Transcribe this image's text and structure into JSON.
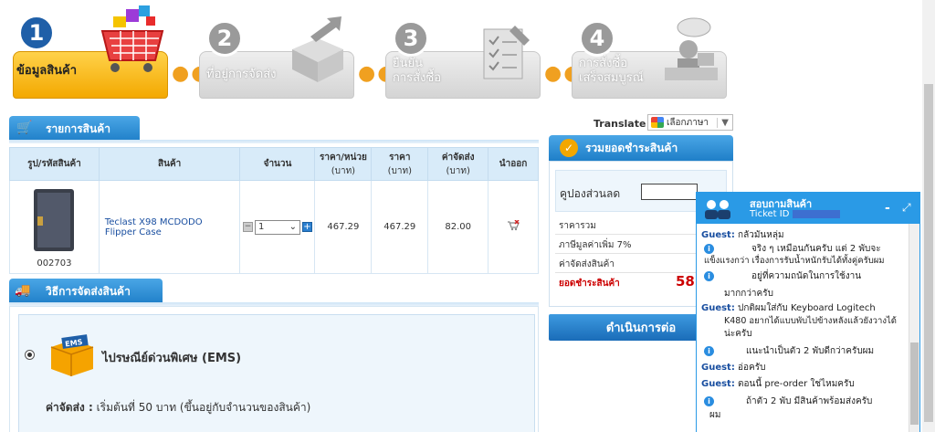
{
  "steps": [
    {
      "num": "1",
      "label": "ข้อมูลสินค้า"
    },
    {
      "num": "2",
      "label": "ที่อยู่การจัดส่ง"
    },
    {
      "num": "3",
      "label1": "ยืนยัน",
      "label2": "การสั่งซื้อ"
    },
    {
      "num": "4",
      "label1": "การสั่งซื้อ",
      "label2": "เสร็จสมบูรณ์"
    }
  ],
  "cart": {
    "title": "รายการสินค้า",
    "headers": {
      "image": "รูป/รหัสสินค้า",
      "product": "สินค้า",
      "qty": "จำนวน",
      "unit_price": "ราคา/หน่วย",
      "unit_price_sub": "(บาท)",
      "price": "ราคา",
      "price_sub": "(บาท)",
      "shipping": "ค่าจัดส่ง",
      "shipping_sub": "(บาท)",
      "remove": "นำออก"
    },
    "item": {
      "code": "002703",
      "name": "Teclast X98 MCDODO Flipper Case",
      "qty": "1",
      "unit_price": "467.29",
      "price": "467.29",
      "shipping": "82.00"
    }
  },
  "shipping": {
    "title": "วิธีการจัดส่งสินค้า",
    "method": "ไปรษณีย์ด่วนพิเศษ (EMS)",
    "logo_text": "EMS",
    "fee_label": "ค่าจัดส่ง :",
    "fee_text": "เริ่มต้นที่ 50 บาท (ขึ้นอยู่กับจำนวนของสินค้า)"
  },
  "translate": {
    "label": "Translate :",
    "select": "เลือกภาษา"
  },
  "summary": {
    "title": "รวมยอดชำระสินค้า",
    "coupon_label": "คูปองส่วนลด",
    "rows": [
      "ราคารวม",
      "ภาษีมูลค่าเพิ่ม 7%",
      "ค่าจัดส่งสินค้า"
    ],
    "total_label": "ยอดชำระสินค้า",
    "total_value": "58",
    "proceed": "ดำเนินการต่อ"
  },
  "chat": {
    "title": "สอบถามสินค้า",
    "ticket": "Ticket ID",
    "minimize": "-",
    "expand": "⤢",
    "lines": [
      {
        "who": "Guest:",
        "text": "กลัวมันหลุ่ม"
      },
      {
        "who": "",
        "text": "จริง ๆ เหมือนกันครับ แต่ 2 พับจะ"
      },
      {
        "who": "",
        "text": "แข็งแรงกว่า เรื่องการรับน้ำหนักรับได้ทั้งคู่ครับผม"
      },
      {
        "who": "",
        "text": "อยู่ที่ความถนัดในการใช้งาน"
      },
      {
        "who": "",
        "text": "มากกว่าครับ"
      },
      {
        "who": "Guest:",
        "text": "ปกติผมใส่กับ Keyboard Logitech"
      },
      {
        "who": "",
        "text": "K480 อยากได้แบบพับไปข้างหลังแล้วยังวางได้"
      },
      {
        "who": "",
        "text": "น่ะครับ"
      },
      {
        "who": "",
        "text": "แนะนำเป็นตัว 2 พับดีกว่าครับผม"
      },
      {
        "who": "Guest:",
        "text": "อ่อครับ"
      },
      {
        "who": "Guest:",
        "text": "ตอนนี้ pre-order ใช่ไหมครับ"
      },
      {
        "who": "",
        "text": "ถ้าตัว 2 พับ มีสินค้าพร้อมส่งครับ"
      },
      {
        "who": "",
        "text": "ผม"
      }
    ]
  },
  "colors": {
    "accent": "#1f7fc8",
    "orange": "#f0a020",
    "red": "#cc0000"
  }
}
